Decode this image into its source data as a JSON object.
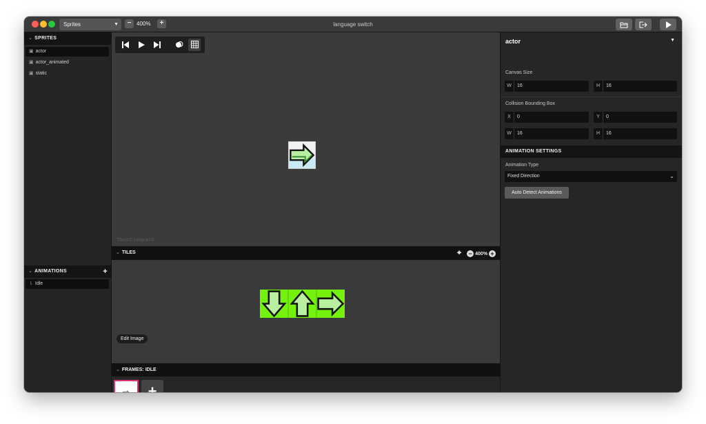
{
  "titlebar": {
    "section_select": "Sprites",
    "zoom_minus": "−",
    "zoom_level": "400%",
    "zoom_plus": "+",
    "window_title": "language switch"
  },
  "sidebar": {
    "sprites_header": "SPRITES",
    "sprites": [
      {
        "label": "actor",
        "selected": true
      },
      {
        "label": "actor_animated",
        "selected": false
      },
      {
        "label": "static",
        "selected": false
      }
    ],
    "animations_header": "ANIMATIONS",
    "animations_add": "+",
    "animations": [
      {
        "label": "Idle",
        "selected": true
      }
    ]
  },
  "canvas": {
    "tiles_info": "Tiles=2  Unique=6"
  },
  "tiles_panel": {
    "header": "TILES",
    "zoom_level": "400%",
    "edit_image_label": "Edit Image",
    "strip_color": "#74f20e"
  },
  "frames_panel": {
    "header": "FRAMES: IDLE",
    "frame_glyph": "⇨",
    "add_glyph": "+"
  },
  "inspector": {
    "title": "actor",
    "canvas_size_label": "Canvas Size",
    "canvas_w_key": "W",
    "canvas_w": "16",
    "canvas_h_key": "H",
    "canvas_h": "16",
    "collision_label": "Collision Bounding Box",
    "coll_x_key": "X",
    "coll_x": "0",
    "coll_y_key": "Y",
    "coll_y": "0",
    "coll_w_key": "W",
    "coll_w": "16",
    "coll_h_key": "H",
    "coll_h": "16",
    "animation_settings_header": "ANIMATION SETTINGS",
    "animation_type_label": "Animation Type",
    "animation_type_value": "Fixed Direction",
    "auto_detect_label": "Auto Detect Animations"
  },
  "colors": {
    "accent_frame_border": "#e0307a",
    "tile_green": "#74f20e",
    "sprite_fill": "#b8f0a0",
    "sprite_bg": "#c9e9f3"
  },
  "icons": [
    "open-folder-icon",
    "export-icon",
    "play-icon",
    "skip-start-icon",
    "play-icon",
    "skip-end-icon",
    "onion-skin-icon",
    "grid-icon",
    "crosshair-icon"
  ]
}
